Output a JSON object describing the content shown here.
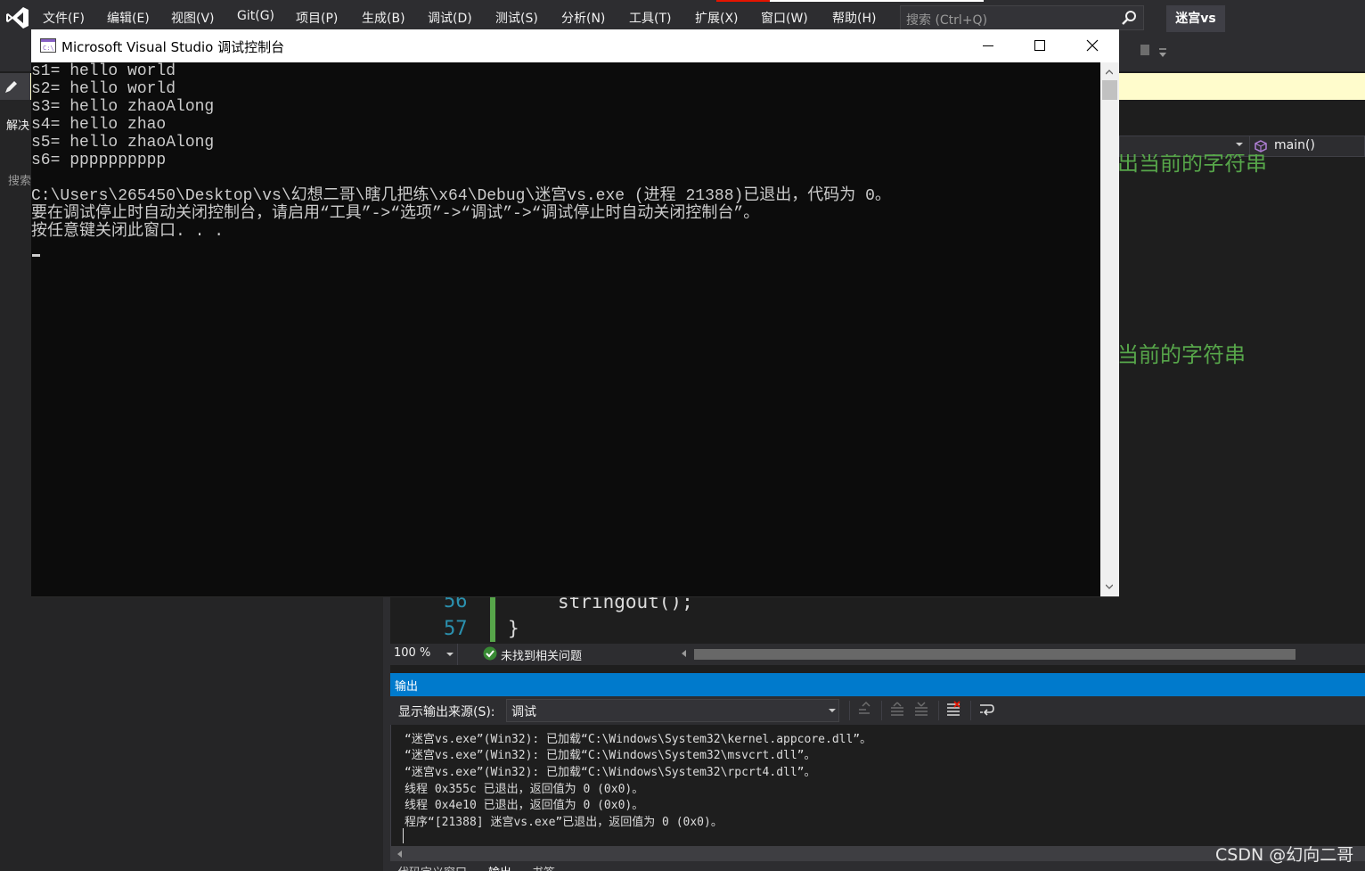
{
  "menu": {
    "items": [
      "文件(F)",
      "编辑(E)",
      "视图(V)",
      "Git(G)",
      "项目(P)",
      "生成(B)",
      "调试(D)",
      "测试(S)",
      "分析(N)",
      "工具(T)",
      "扩展(X)",
      "窗口(W)",
      "帮助(H)"
    ],
    "search_placeholder": "搜索 (Ctrl+Q)",
    "solution_name": "迷宫vs"
  },
  "left_panel": {
    "title_fragment": "解决",
    "search_fragment": "搜索"
  },
  "editor": {
    "navigation": {
      "function": "main()"
    },
    "comments": [
      "出当前的字符串",
      "当前的字符串"
    ],
    "lines": [
      {
        "number": "56",
        "code": "stringout();"
      },
      {
        "number": "57",
        "code": "}"
      }
    ],
    "status": {
      "zoom": "100 %",
      "issues": "未找到相关问题"
    }
  },
  "output": {
    "title": "输出",
    "source_label": "显示输出来源(S):",
    "source_value": "调试",
    "lines": [
      "“迷宫vs.exe”(Win32): 已加载“C:\\Windows\\System32\\kernel.appcore.dll”。",
      "“迷宫vs.exe”(Win32): 已加载“C:\\Windows\\System32\\msvcrt.dll”。",
      "“迷宫vs.exe”(Win32): 已加载“C:\\Windows\\System32\\rpcrt4.dll”。",
      "线程 0x355c 已退出，返回值为 0 (0x0)。",
      "线程 0x4e10 已退出，返回值为 0 (0x0)。",
      "程序“[21388] 迷宫vs.exe”已退出，返回值为 0 (0x0)。"
    ],
    "tabs": [
      "代码定义窗口",
      "输出",
      "书签"
    ]
  },
  "console": {
    "title": "Microsoft Visual Studio 调试控制台",
    "lines": [
      "s1= hello world",
      "s2= hello world",
      "s3= hello zhaoAlong",
      "s4= hello zhao",
      "s5= hello zhaoAlong",
      "s6= pppppppppp",
      "",
      "C:\\Users\\265450\\Desktop\\vs\\幻想二哥\\瞎几把练\\x64\\Debug\\迷宫vs.exe (进程 21388)已退出，代码为 0。",
      "要在调试停止时自动关闭控制台，请启用“工具”->“选项”->“调试”->“调试停止时自动关闭控制台”。",
      "按任意键关闭此窗口. . ."
    ]
  },
  "watermark": "CSDN @幻向二哥",
  "colors": {
    "vs_purple": "#865fc5",
    "accent_blue": "#007acc",
    "comment_green": "#57a64a",
    "line_number_blue": "#2b91af"
  },
  "icons": {
    "logo": "visual-studio-logo-icon",
    "search": "search-icon",
    "ok": "check-circle-icon",
    "minimize": "minimize-icon",
    "maximize": "maximize-icon",
    "close": "close-icon"
  }
}
